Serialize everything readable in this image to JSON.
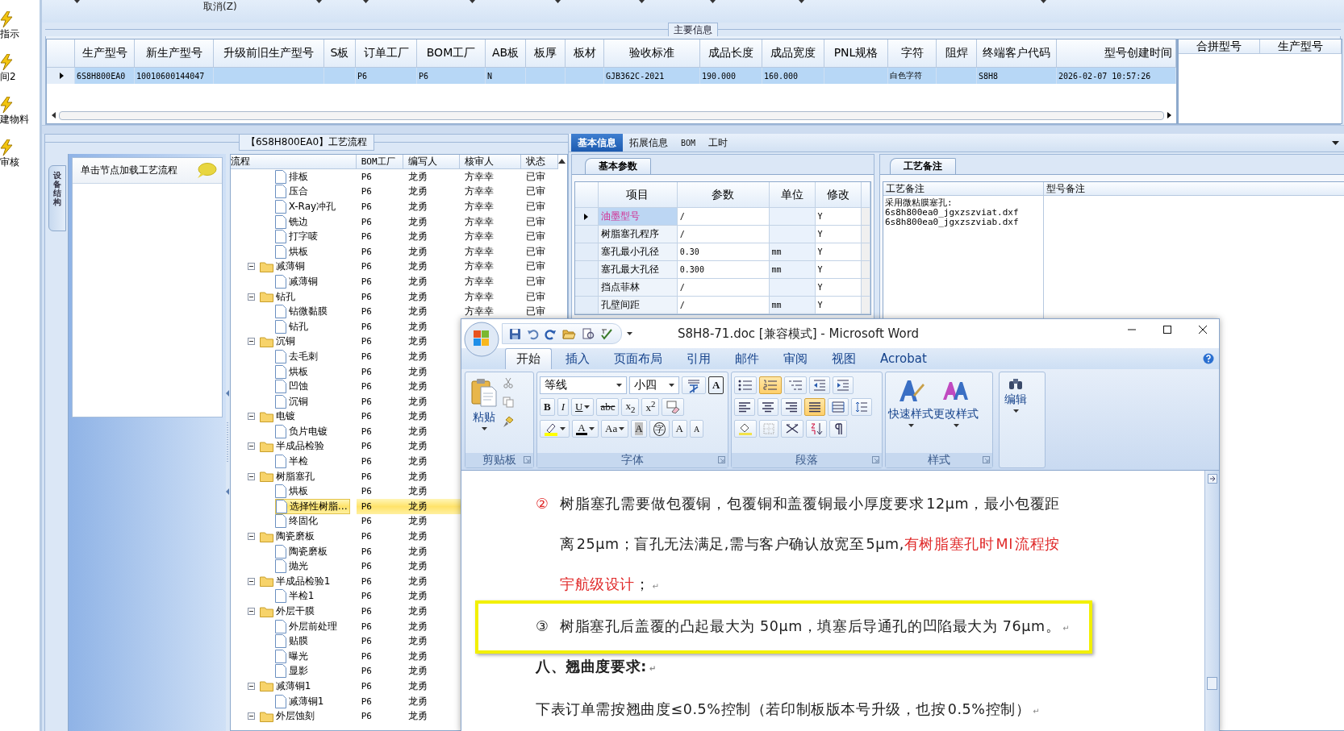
{
  "left_strip": {
    "items": [
      {
        "label": "指示"
      },
      {
        "label": "间2"
      },
      {
        "label": "建物料"
      },
      {
        "label": "审核"
      }
    ]
  },
  "toolbar": {
    "buttons": [
      {
        "label": "取消(Z)"
      }
    ]
  },
  "main_info": {
    "title": "主要信息",
    "columns": [
      "生产型号",
      "新生产型号",
      "升级前旧生产型号",
      "S板",
      "订单工厂",
      "BOM工厂",
      "AB板",
      "板厚",
      "板材",
      "验收标准",
      "成品长度",
      "成品宽度",
      "PNL规格",
      "字符",
      "阻焊",
      "终端客户代码",
      "型号创建时间"
    ],
    "rows": [
      {
        "selected": true,
        "cells": [
          "6S8H800EA0",
          "10010600144047",
          null,
          null,
          "P6",
          "P6",
          "N",
          null,
          null,
          "GJB362C-2021",
          "190.000",
          "160.000",
          null,
          "白色字符",
          null,
          "S8H8",
          "2026-02-07 10:57:26"
        ]
      }
    ]
  },
  "merge_grid": {
    "columns": [
      "合拼型号",
      "生产型号"
    ]
  },
  "process_panel": {
    "title": "【6S8H800EA0】工艺流程",
    "side_tab": "设备结构",
    "hint": "单击节点加载工艺流程",
    "columns": [
      "流程",
      "BOM工厂",
      "编写人",
      "核审人",
      "状态"
    ],
    "nodes": [
      {
        "children": [
          {
            "kind": "leaf",
            "label": "排板",
            "bom": "P6",
            "writer": "龙勇",
            "reviewer": "方幸幸",
            "status": "已审",
            "selected": false
          },
          {
            "kind": "leaf",
            "label": "压合",
            "bom": "P6",
            "writer": "龙勇",
            "reviewer": "方幸幸",
            "status": "已审",
            "selected": false
          },
          {
            "kind": "leaf",
            "label": "X-Ray冲孔",
            "bom": "P6",
            "writer": "龙勇",
            "reviewer": "方幸幸",
            "status": "已审",
            "selected": false
          },
          {
            "kind": "leaf",
            "label": "铣边",
            "bom": "P6",
            "writer": "龙勇",
            "reviewer": "方幸幸",
            "status": "已审",
            "selected": false
          },
          {
            "kind": "leaf",
            "label": "打字唛",
            "bom": "P6",
            "writer": "龙勇",
            "reviewer": "方幸幸",
            "status": "已审",
            "selected": false
          },
          {
            "kind": "leaf",
            "label": "烘板",
            "bom": "P6",
            "writer": "龙勇",
            "reviewer": "方幸幸",
            "status": "已审",
            "selected": false
          }
        ]
      },
      {
        "kind": "folder",
        "label": "减薄铜",
        "bom": "P6",
        "writer": "龙勇",
        "reviewer": "方幸幸",
        "status": "已审",
        "selected": false,
        "expanded": true,
        "children": [
          {
            "kind": "leaf",
            "label": "减薄铜",
            "bom": "P6",
            "writer": "龙勇",
            "reviewer": "方幸幸",
            "status": "已审",
            "selected": false
          }
        ]
      },
      {
        "kind": "folder",
        "label": "钻孔",
        "bom": "P6",
        "writer": "龙勇",
        "reviewer": "方幸幸",
        "status": "已审",
        "selected": false,
        "expanded": true,
        "children": [
          {
            "kind": "leaf",
            "label": "钻微黏膜",
            "bom": "P6",
            "writer": "龙勇",
            "reviewer": "方幸幸",
            "status": "已审",
            "selected": false
          },
          {
            "kind": "leaf",
            "label": "钻孔",
            "bom": "P6",
            "writer": "龙勇",
            "selected": false
          }
        ]
      },
      {
        "kind": "folder",
        "label": "沉铜",
        "bom": "P6",
        "writer": "龙勇",
        "selected": false,
        "expanded": true,
        "children": [
          {
            "kind": "leaf",
            "label": "去毛刺",
            "bom": "P6",
            "writer": "龙勇",
            "selected": false
          },
          {
            "kind": "leaf",
            "label": "烘板",
            "bom": "P6",
            "writer": "龙勇",
            "selected": false
          },
          {
            "kind": "leaf",
            "label": "凹蚀",
            "bom": "P6",
            "writer": "龙勇",
            "selected": false
          },
          {
            "kind": "leaf",
            "label": "沉铜",
            "bom": "P6",
            "writer": "龙勇",
            "selected": false
          }
        ]
      },
      {
        "kind": "folder",
        "label": "电镀",
        "bom": "P6",
        "writer": "龙勇",
        "selected": false,
        "expanded": true,
        "children": [
          {
            "kind": "leaf",
            "label": "负片电镀",
            "bom": "P6",
            "writer": "龙勇",
            "selected": false
          }
        ]
      },
      {
        "kind": "folder",
        "label": "半成品检验",
        "bom": "P6",
        "writer": "龙勇",
        "selected": false,
        "expanded": true,
        "children": [
          {
            "kind": "leaf",
            "label": "半检",
            "bom": "P6",
            "writer": "龙勇",
            "selected": false
          }
        ]
      },
      {
        "kind": "folder",
        "label": "树脂塞孔",
        "bom": "P6",
        "writer": "龙勇",
        "selected": false,
        "expanded": true,
        "children": [
          {
            "kind": "leaf",
            "label": "烘板",
            "bom": "P6",
            "writer": "龙勇",
            "selected": false
          },
          {
            "kind": "leaf",
            "label": "选择性树脂…",
            "bom": "P6",
            "writer": "龙勇",
            "selected": true
          },
          {
            "kind": "leaf",
            "label": "终固化",
            "bom": "P6",
            "writer": "龙勇",
            "selected": false
          }
        ]
      },
      {
        "kind": "folder",
        "label": "陶瓷磨板",
        "bom": "P6",
        "writer": "龙勇",
        "selected": false,
        "expanded": true,
        "children": [
          {
            "kind": "leaf",
            "label": "陶瓷磨板",
            "bom": "P6",
            "writer": "龙勇",
            "selected": false
          },
          {
            "kind": "leaf",
            "label": "抛光",
            "bom": "P6",
            "writer": "龙勇",
            "selected": false
          }
        ]
      },
      {
        "kind": "folder",
        "label": "半成品检验1",
        "bom": "P6",
        "writer": "龙勇",
        "selected": false,
        "expanded": true,
        "children": [
          {
            "kind": "leaf",
            "label": "半检1",
            "bom": "P6",
            "writer": "龙勇",
            "selected": false
          }
        ]
      },
      {
        "kind": "folder",
        "label": "外层干膜",
        "bom": "P6",
        "writer": "龙勇",
        "selected": false,
        "expanded": true,
        "children": [
          {
            "kind": "leaf",
            "label": "外层前处理",
            "bom": "P6",
            "writer": "龙勇",
            "selected": false
          },
          {
            "kind": "leaf",
            "label": "贴膜",
            "bom": "P6",
            "writer": "龙勇",
            "selected": false
          },
          {
            "kind": "leaf",
            "label": "曝光",
            "bom": "P6",
            "writer": "龙勇",
            "selected": false
          },
          {
            "kind": "leaf",
            "label": "显影",
            "bom": "P6",
            "writer": "龙勇",
            "selected": false
          }
        ]
      },
      {
        "kind": "folder",
        "label": "减薄铜1",
        "bom": "P6",
        "writer": "龙勇",
        "selected": false,
        "expanded": true,
        "children": [
          {
            "kind": "leaf",
            "label": "减薄铜1",
            "bom": "P6",
            "writer": "龙勇",
            "selected": false
          }
        ]
      },
      {
        "kind": "folder",
        "label": "外层蚀刻",
        "bom": "P6",
        "writer": "龙勇",
        "selected": false,
        "expanded": true
      }
    ]
  },
  "detail_panel": {
    "tabs": [
      {
        "label": "基本信息",
        "selected": true
      },
      {
        "label": "拓展信息",
        "selected": false
      },
      {
        "label": "BOM",
        "selected": false
      },
      {
        "label": "工时",
        "selected": false
      }
    ],
    "params": {
      "tab": "基本参数",
      "columns": [
        "项目",
        "参数",
        "单位",
        "修改"
      ],
      "rows": [
        {
          "item": "油墨型号",
          "value": "/",
          "unit": null,
          "modify": "Y",
          "selected": true
        },
        {
          "item": "树脂塞孔程序",
          "value": "/",
          "unit": null,
          "modify": "Y",
          "selected": false
        },
        {
          "item": "塞孔最小孔径",
          "value": "0.30",
          "unit": "mm",
          "modify": "Y",
          "selected": false
        },
        {
          "item": "塞孔最大孔径",
          "value": "0.300",
          "unit": "mm",
          "modify": "Y",
          "selected": false
        },
        {
          "item": "挡点菲林",
          "value": "/",
          "unit": null,
          "modify": "Y",
          "selected": false
        },
        {
          "item": "孔壁间距",
          "value": "/",
          "unit": "mm",
          "modify": "Y",
          "selected": false
        }
      ]
    },
    "notes": {
      "tab": "工艺备注",
      "columns": [
        "工艺备注",
        "型号备注"
      ],
      "process_note": "采用微粘膜塞孔:\n6s8h800ea0_jgxzszviat.dxf\n6s8h800ea0_jgxzszviab.dxf"
    }
  },
  "word": {
    "title": "S8H8-71.doc [兼容模式] - Microsoft Word",
    "tabs": [
      {
        "label": "开始",
        "selected": true
      },
      {
        "label": "插入",
        "selected": false
      },
      {
        "label": "页面布局",
        "selected": false
      },
      {
        "label": "引用",
        "selected": false
      },
      {
        "label": "邮件",
        "selected": false
      },
      {
        "label": "审阅",
        "selected": false
      },
      {
        "label": "视图",
        "selected": false
      },
      {
        "label": "Acrobat",
        "selected": false
      }
    ],
    "ribbon": {
      "paste": "粘贴",
      "font_name": "等线",
      "font_size": "小四",
      "char_border": "A",
      "font_row_1": [
        {
          "kind": "bold",
          "label": "B",
          "menu": false
        },
        {
          "kind": "italic",
          "label": "I",
          "menu": false
        },
        {
          "kind": "underline",
          "label": "U",
          "menu": true
        },
        {
          "kind": "strike",
          "label": "abc",
          "menu": false
        },
        {
          "kind": "plain",
          "label": "x$_{2}$",
          "menu": false
        },
        {
          "kind": "plain",
          "label": "x$^{2}$",
          "menu": false
        }
      ],
      "font_row_2": [
        {
          "kind": "color",
          "label": "A",
          "menu": true
        },
        {
          "kind": "plain",
          "label": "Aa",
          "menu": true
        },
        {
          "kind": "shaded",
          "label": "A",
          "menu": false
        },
        {
          "kind": "enclosed",
          "label": "字",
          "menu": false
        },
        {
          "kind": "plain",
          "label": "A",
          "menu": false
        },
        {
          "kind": "small",
          "label": "A",
          "menu": false
        }
      ],
      "styles": [
        "快速样式",
        "更改样式"
      ],
      "edit": "编辑",
      "groups": [
        "剪贴板",
        "字体",
        "段落",
        "样式"
      ]
    },
    "paragraphs": [
      {
        "kind": "numbered",
        "marker": {
          "text": "②",
          "color": "#e02a2a"
        },
        "framed": false,
        "segments": [
          {
            "text": "树脂塞孔需要做包覆铜，包覆铜和盖覆铜最小厚度要求 12μm，最小包覆距离 25μm；盲孔无法满足,需与客户确认放宽至 5μm,",
            "color": "#1e1e1e"
          },
          {
            "text": "有树脂塞孔时 MI 流程按宇航级设计",
            "color": "#e02a2a"
          },
          {
            "text": "；",
            "color": "#1e1e1e"
          }
        ],
        "end_mark": "↵"
      },
      {
        "kind": "numbered",
        "marker": {
          "text": "③",
          "color": "#1e1e1e"
        },
        "framed": true,
        "segments": [
          {
            "text": "树脂塞孔后盖覆的凸起最大为 50μm，填塞后导通孔的凹陷最大为 76μm。",
            "color": "#1e1e1e"
          }
        ],
        "end_mark": "↵"
      },
      {
        "kind": "heading",
        "framed": false,
        "segments": [
          {
            "text": "八、翘曲度要求:",
            "color": "#1e1e1e"
          }
        ],
        "end_mark": "↵"
      },
      {
        "kind": "body",
        "framed": false,
        "segments": [
          {
            "text": "下表订单需按翘曲度≤0.5%控制（若印制板版本号升级，也按 0.5%控制）",
            "color": "#1e1e1e"
          }
        ],
        "end_mark": "↵"
      }
    ]
  }
}
